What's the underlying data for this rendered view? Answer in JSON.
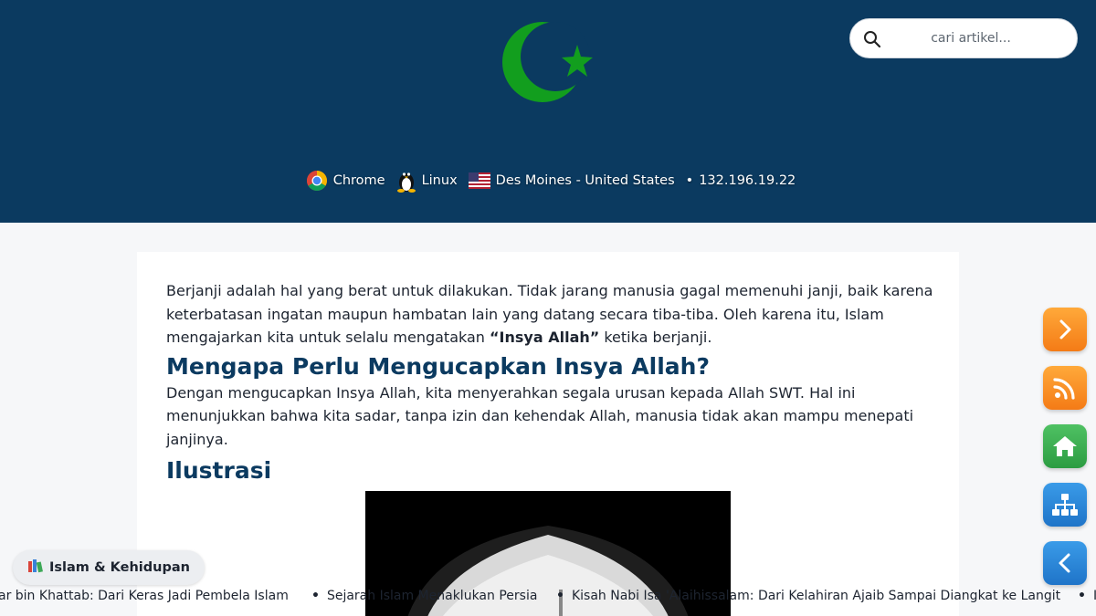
{
  "header": {
    "logo_icon": "crescent-star-icon",
    "brand_color": "#0b3a60",
    "logo_color": "#129e1e"
  },
  "search": {
    "placeholder": "cari artikel..."
  },
  "visitor_info": {
    "browser": "Chrome",
    "os": "Linux",
    "location": "Des Moines - United States",
    "separator": "•",
    "ip": "132.196.19.22"
  },
  "article": {
    "intro_p1": "Berjanji adalah hal yang berat untuk dilakukan. Tidak jarang manusia gagal memenuhi janji, baik karena keterbatasan ingatan maupun hambatan lain yang datang secara tiba-tiba. Oleh karena itu, Islam mengajarkan kita untuk selalu mengatakan ",
    "intro_bold": "“Insya Allah”",
    "intro_p2": " ketika berjanji.",
    "heading1": "Mengapa Perlu Mengucapkan Insya Allah?",
    "paragraph2": "Dengan mengucapkan Insya Allah, kita menyerahkan segala urusan kepada Allah SWT. Hal ini menunjukkan bahwa kita sadar, tanpa izin dan kehendak Allah, manusia tidak akan mampu menepati janjinya.",
    "heading2": "Ilustrasi"
  },
  "side_buttons": [
    {
      "icon": "chevron-right-icon",
      "color": "#f47b16"
    },
    {
      "icon": "rss-icon",
      "color": "#f47b16"
    },
    {
      "icon": "home-icon",
      "color": "#2c9c42"
    },
    {
      "icon": "sitemap-icon",
      "color": "#1f74c8"
    },
    {
      "icon": "chevron-left-icon",
      "color": "#1f74c8"
    }
  ],
  "category_chip": {
    "icon": "books-icon",
    "label": "Islam & Kehidupan"
  },
  "ticker": {
    "items": [
      "ar bin Khattab: Dari Keras Jadi Pembela Islam",
      "Sejarah Islam Menaklukan Persia",
      "Kisah Nabi Isa 'Alaihissalam: Dari Kelahiran Ajaib Sampai Diangkat ke Langit",
      "Is"
    ]
  }
}
